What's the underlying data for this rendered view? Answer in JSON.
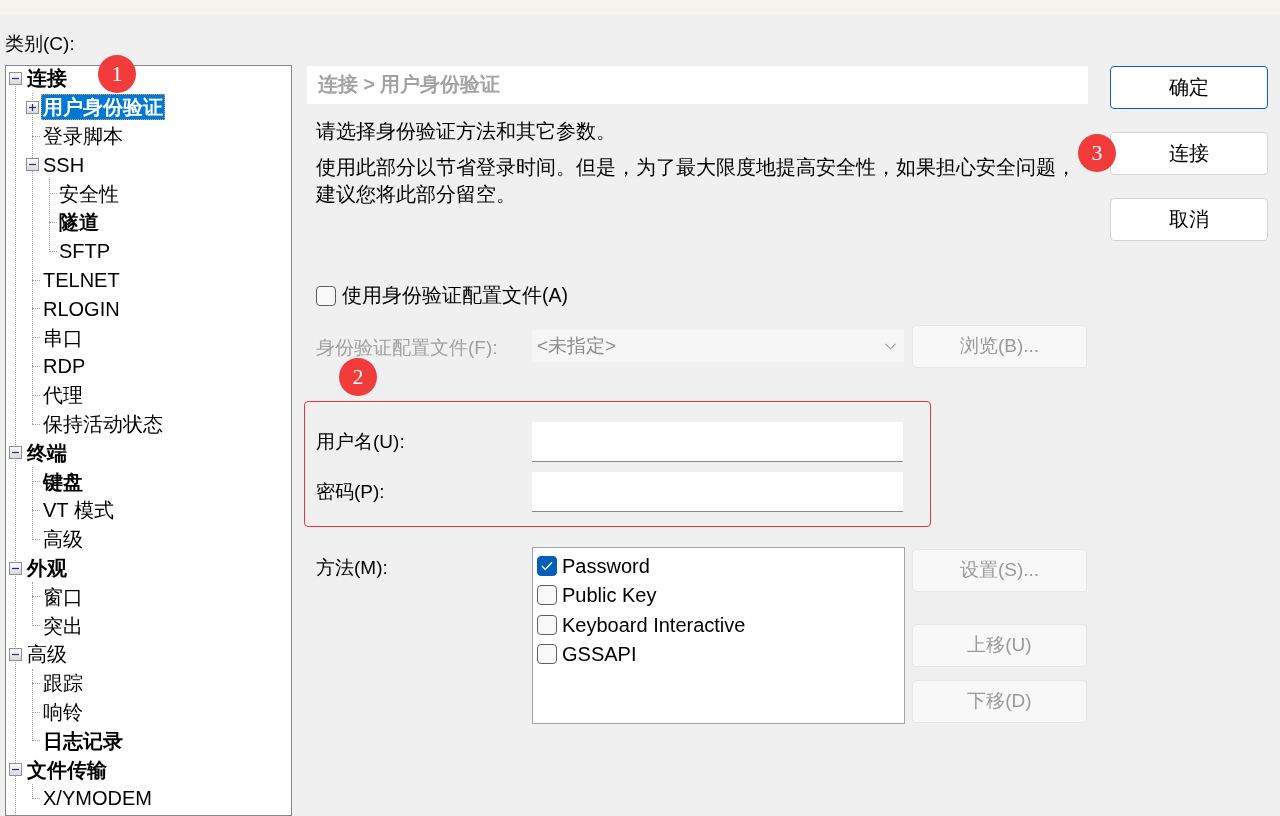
{
  "window": {
    "category_label": "类别(C):"
  },
  "tree": {
    "badge": "1",
    "items": [
      {
        "label": "连接",
        "bold": true,
        "selected": false,
        "expanded": true,
        "children": [
          {
            "label": "用户身份验证",
            "bold": true,
            "selected": true,
            "expanded": false
          },
          {
            "label": "登录脚本",
            "bold": false,
            "selected": false
          },
          {
            "label": "SSH",
            "bold": false,
            "selected": false,
            "expanded": true,
            "children": [
              {
                "label": "安全性",
                "bold": false,
                "selected": false
              },
              {
                "label": "隧道",
                "bold": true,
                "selected": false
              },
              {
                "label": "SFTP",
                "bold": false,
                "selected": false
              }
            ]
          },
          {
            "label": "TELNET",
            "bold": false,
            "selected": false
          },
          {
            "label": "RLOGIN",
            "bold": false,
            "selected": false
          },
          {
            "label": "串口",
            "bold": false,
            "selected": false
          },
          {
            "label": "RDP",
            "bold": false,
            "selected": false
          },
          {
            "label": "代理",
            "bold": false,
            "selected": false
          },
          {
            "label": "保持活动状态",
            "bold": false,
            "selected": false
          }
        ]
      },
      {
        "label": "终端",
        "bold": true,
        "selected": false,
        "expanded": true,
        "children": [
          {
            "label": "键盘",
            "bold": true,
            "selected": false
          },
          {
            "label": "VT 模式",
            "bold": false,
            "selected": false
          },
          {
            "label": "高级",
            "bold": false,
            "selected": false
          }
        ]
      },
      {
        "label": "外观",
        "bold": true,
        "selected": false,
        "expanded": true,
        "children": [
          {
            "label": "窗口",
            "bold": false,
            "selected": false
          },
          {
            "label": "突出",
            "bold": false,
            "selected": false
          }
        ]
      },
      {
        "label": "高级",
        "bold": false,
        "selected": false,
        "expanded": true,
        "children": [
          {
            "label": "跟踪",
            "bold": false,
            "selected": false
          },
          {
            "label": "响铃",
            "bold": false,
            "selected": false
          },
          {
            "label": "日志记录",
            "bold": true,
            "selected": false
          }
        ]
      },
      {
        "label": "文件传输",
        "bold": true,
        "selected": false,
        "expanded": true,
        "children": [
          {
            "label": "X/YMODEM",
            "bold": false,
            "selected": false
          }
        ]
      }
    ]
  },
  "panel": {
    "breadcrumb": "连接 > 用户身份验证",
    "intro": "请选择身份验证方法和其它参数。",
    "description": "使用此部分以节省登录时间。但是，为了最大限度地提高安全性，如果担心安全问题，建议您将此部分留空。",
    "profile_checkbox": {
      "label": "使用身份验证配置文件(A)",
      "checked": false
    },
    "profile_field": {
      "label": "身份验证配置文件(F):",
      "value": "<未指定>",
      "disabled": true
    },
    "browse_button": {
      "label": "浏览(B)...",
      "disabled": true
    },
    "credentials": {
      "badge": "2",
      "highlighted": true,
      "fields": [
        {
          "label": "用户名(U):"
        },
        {
          "label": "密码(P):"
        }
      ]
    },
    "methods": {
      "label": "方法(M):",
      "items": [
        {
          "label": "Password",
          "checked": true
        },
        {
          "label": "Public Key",
          "checked": false
        },
        {
          "label": "Keyboard Interactive",
          "checked": false
        },
        {
          "label": "GSSAPI",
          "checked": false
        }
      ],
      "buttons": [
        {
          "label": "设置(S)...",
          "disabled": true
        },
        {
          "label": "上移(U)",
          "disabled": true
        },
        {
          "label": "下移(D)",
          "disabled": true
        }
      ]
    }
  },
  "dialog_buttons": [
    {
      "label": "确定",
      "default": true
    },
    {
      "label": "连接",
      "default": false,
      "badge": "3"
    },
    {
      "label": "取消",
      "default": false
    }
  ]
}
